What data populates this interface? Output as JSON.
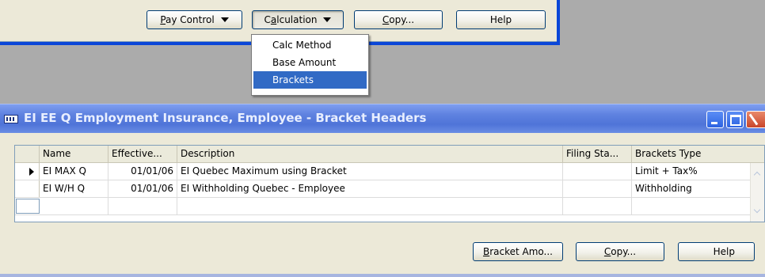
{
  "top_toolbar": {
    "pay_control": {
      "mnemonic": "P",
      "rest": "ay Control"
    },
    "calculation": {
      "prefix": "C",
      "mnemonic": "a",
      "rest": "lculation"
    },
    "copy": {
      "mnemonic": "C",
      "rest": "opy..."
    },
    "help": "Help"
  },
  "calculation_menu": {
    "items": [
      "Calc Method",
      "Base Amount",
      "Brackets"
    ],
    "selected": "Brackets"
  },
  "window": {
    "title": "EI EE Q Employment Insurance, Employee - Bracket Headers"
  },
  "grid": {
    "columns": [
      "Name",
      "Effective...",
      "Description",
      "Filing Sta...",
      "Brackets Type"
    ],
    "rows": [
      {
        "name": "EI MAX Q",
        "effective": "01/01/06",
        "description": "EI Quebec Maximum using Bracket",
        "filing_status": "",
        "brackets_type": "Limit + Tax%"
      },
      {
        "name": "EI W/H Q",
        "effective": "01/01/06",
        "description": "EI Withholding Quebec - Employee",
        "filing_status": "",
        "brackets_type": "Withholding"
      }
    ]
  },
  "bottom_buttons": {
    "bracket_amounts": {
      "mnemonic": "B",
      "rest": "racket Amo..."
    },
    "copy": {
      "mnemonic": "C",
      "rest": "opy..."
    },
    "help": "Help"
  }
}
